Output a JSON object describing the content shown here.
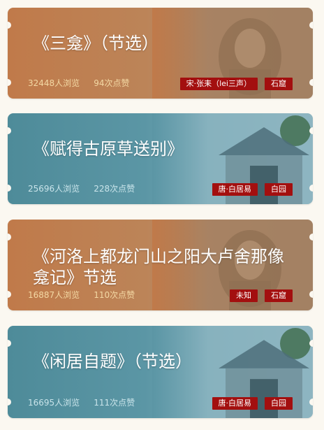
{
  "cards": [
    {
      "title": "《三龛》（节选）",
      "views": "32448人浏览",
      "likes": "94次点赞",
      "tags": [
        "宋·张耒（lei三声）",
        "石窟"
      ],
      "theme": "brown",
      "image_icon": "buddha-statue-icon"
    },
    {
      "title": "《赋得古原草送别》",
      "views": "25696人浏览",
      "likes": "228次点赞",
      "tags": [
        "唐·白居易",
        "白园"
      ],
      "theme": "teal",
      "image_icon": "pavilion-icon"
    },
    {
      "title": "《河洛上都龙门山之阳大卢舍那像龛记》节选",
      "views": "16887人浏览",
      "likes": "110次点赞",
      "tags": [
        "未知",
        "石窟"
      ],
      "theme": "brown",
      "image_icon": "buddha-statue-icon"
    },
    {
      "title": "《闲居自题》（节选）",
      "views": "16695人浏览",
      "likes": "111次点赞",
      "tags": [
        "唐·白居易",
        "白园"
      ],
      "theme": "teal",
      "image_icon": "pavilion-icon"
    }
  ],
  "colors": {
    "page_bg": "#fbf8f1",
    "brown_card": "#c07a4a",
    "teal_card": "#4e8b99",
    "tag_bg": "#a30f0f",
    "title": "#ffffff"
  }
}
